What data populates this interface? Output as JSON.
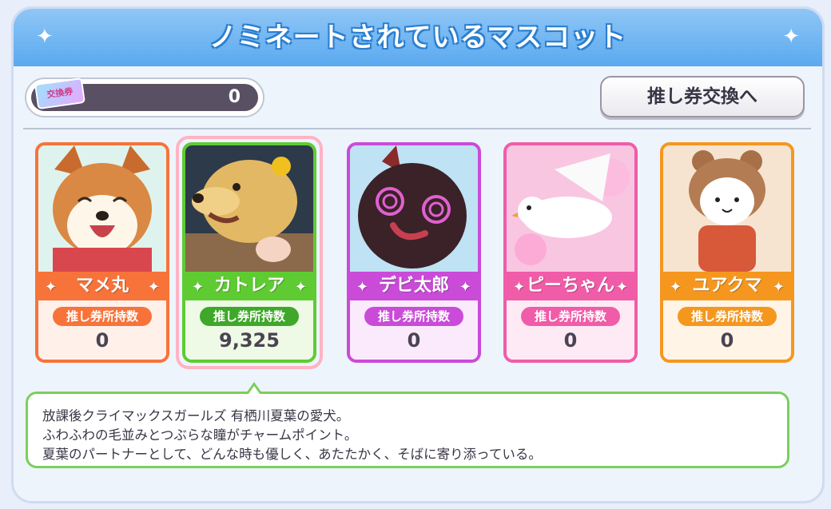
{
  "header": {
    "title": "ノミネートされているマスコット"
  },
  "ticket": {
    "icon_label": "交換券",
    "count": "0"
  },
  "exchange_button": {
    "label": "推し券交換へ"
  },
  "mascots": [
    {
      "name": "マメ丸",
      "badge": "推し券所持数",
      "count": "0",
      "theme": "#f7733a",
      "light": "#fff0ea",
      "art": "shiba-dog"
    },
    {
      "name": "カトレア",
      "badge": "推し券所持数",
      "count": "9,325",
      "theme": "#5fcb33",
      "light": "#eef9e6",
      "art": "golden-retriever",
      "selected": true
    },
    {
      "name": "デビ太郎",
      "badge": "推し券所持数",
      "count": "0",
      "theme": "#c94bd8",
      "light": "#faeafc",
      "art": "devil-blob"
    },
    {
      "name": "ピーちゃん",
      "badge": "推し券所持数",
      "count": "0",
      "theme": "#f05ca8",
      "light": "#fdeaf4",
      "art": "white-dove"
    },
    {
      "name": "ユアクマ",
      "badge": "推し券所持数",
      "count": "0",
      "theme": "#f5971f",
      "light": "#fff4e6",
      "art": "bear-hood"
    }
  ],
  "description": {
    "line1": "放課後クライマックスガールズ 有栖川夏葉の愛犬。",
    "line2": "ふわふわの毛並みとつぶらな瞳がチャームポイント。",
    "line3": "夏葉のパートナーとして、どんな時も優しく、あたたかく、そばに寄り添っている。"
  }
}
